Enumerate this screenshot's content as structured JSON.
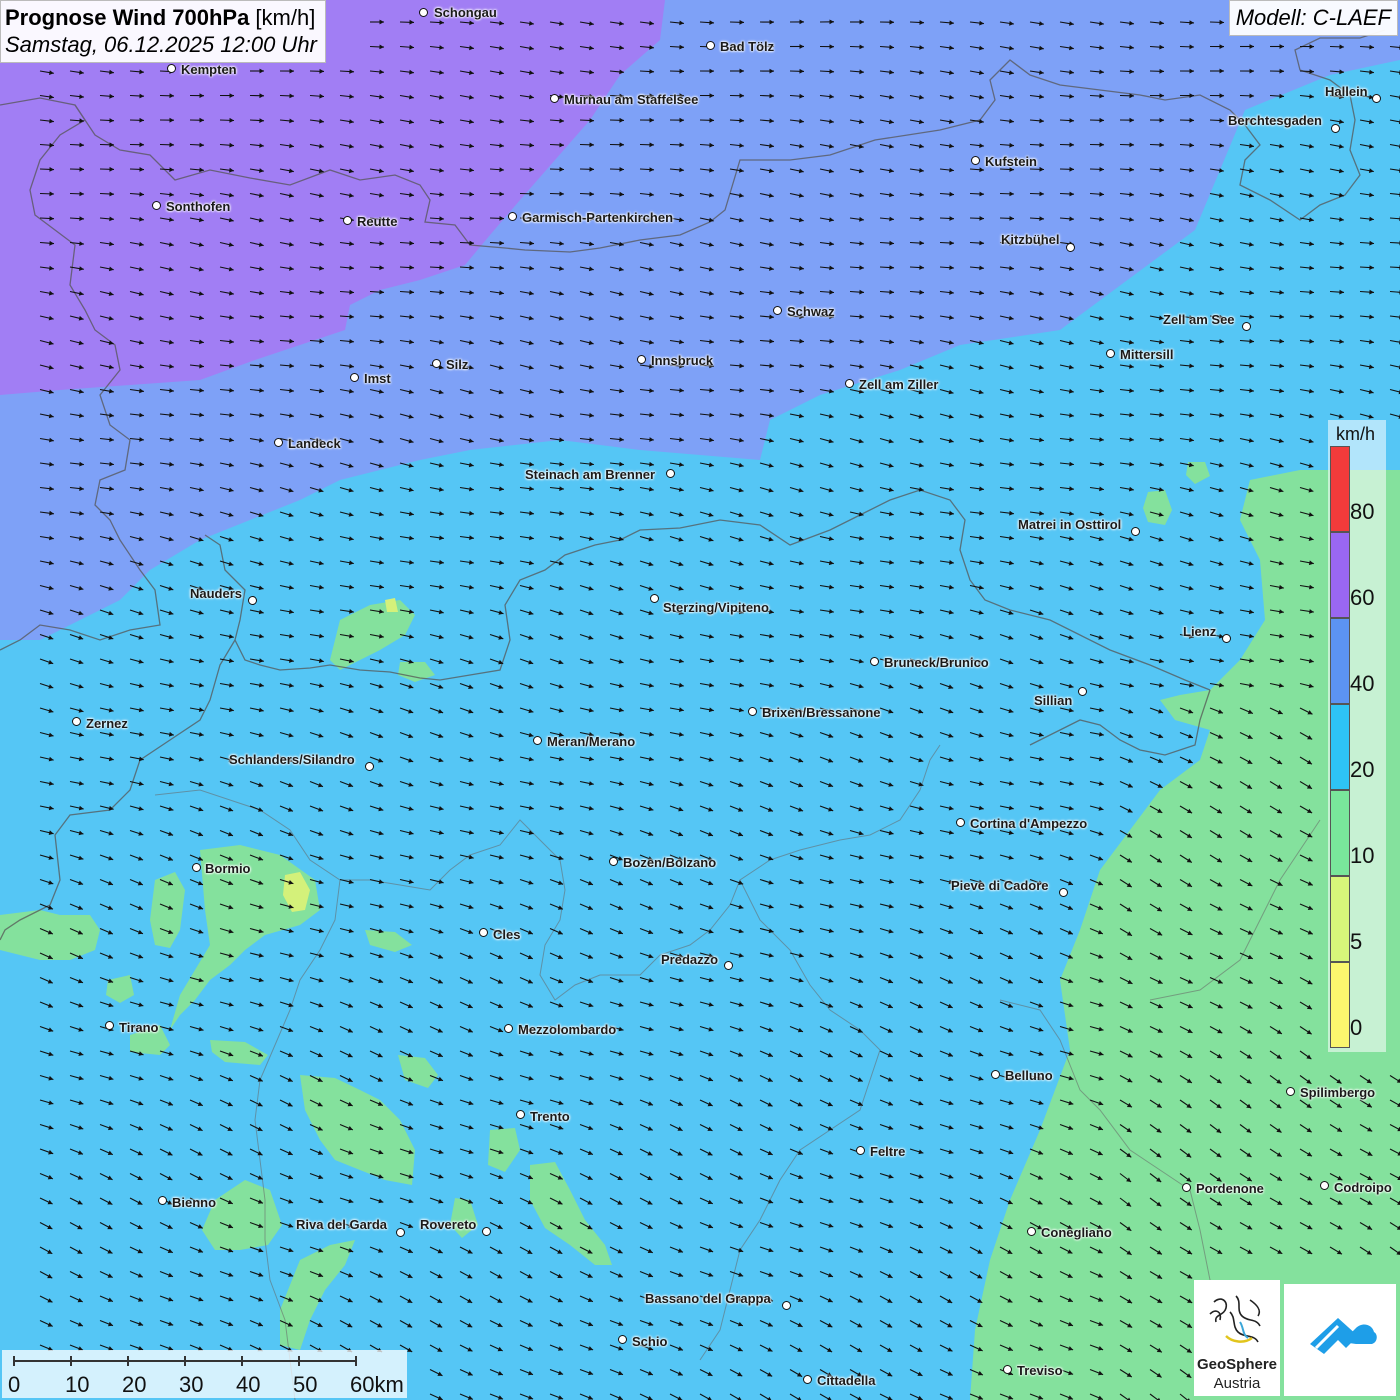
{
  "title": {
    "main_bold": "Prognose Wind 700hPa",
    "unit": " [km/h]",
    "datetime": "Samstag, 06.12.2025 12:00 Uhr"
  },
  "model": "Modell: C-LAEF",
  "legend": {
    "unit": "km/h",
    "labels": [
      "80",
      "60",
      "40",
      "20",
      "10",
      "5",
      "0"
    ],
    "colors": [
      "#f23b3b",
      "#9a67f2",
      "#5c93f3",
      "#2ec3f5",
      "#79e79b",
      "#d8f67a",
      "#fbf76e"
    ]
  },
  "scale": {
    "labels": [
      "0",
      "10",
      "20",
      "30",
      "40",
      "50",
      "60km"
    ]
  },
  "colors": {
    "purple_zone": "#a17ef4",
    "blue_zone": "#7ea1f7",
    "cyan_zone": "#55c6f5",
    "green_zone": "#84e19d",
    "yellow_zone": "#d4f17a"
  },
  "logos": {
    "geosphere_line1": "GeoSphere",
    "geosphere_line2": "Austria"
  },
  "cities": [
    {
      "name": "Schongau",
      "dot": [
        424,
        13
      ],
      "lbl": [
        434,
        5
      ]
    },
    {
      "name": "Bad Tölz",
      "dot": [
        711,
        46
      ],
      "lbl": [
        720,
        39
      ]
    },
    {
      "name": "Kempten",
      "dot": [
        172,
        69
      ],
      "lbl": [
        181,
        62
      ]
    },
    {
      "name": "Murnau am Staffelsee",
      "dot": [
        555,
        99
      ],
      "lbl": [
        564,
        92
      ]
    },
    {
      "name": "Hallein",
      "dot": [
        1377,
        99
      ],
      "lbl": [
        1325,
        84
      ]
    },
    {
      "name": "Berchtesgaden",
      "dot": [
        1336,
        129
      ],
      "lbl": [
        1228,
        113
      ]
    },
    {
      "name": "Kufstein",
      "dot": [
        976,
        161
      ],
      "lbl": [
        985,
        154
      ]
    },
    {
      "name": "Sonthofen",
      "dot": [
        157,
        206
      ],
      "lbl": [
        166,
        199
      ]
    },
    {
      "name": "Reutte",
      "dot": [
        348,
        221
      ],
      "lbl": [
        357,
        214
      ]
    },
    {
      "name": "Garmisch-Partenkirchen",
      "dot": [
        513,
        217
      ],
      "lbl": [
        522,
        210
      ]
    },
    {
      "name": "Kitzbühel",
      "dot": [
        1071,
        248
      ],
      "lbl": [
        1001,
        232
      ]
    },
    {
      "name": "Schwaz",
      "dot": [
        778,
        311
      ],
      "lbl": [
        787,
        304
      ]
    },
    {
      "name": "Zell am See",
      "dot": [
        1247,
        327
      ],
      "lbl": [
        1163,
        312
      ]
    },
    {
      "name": "Mittersill",
      "dot": [
        1111,
        354
      ],
      "lbl": [
        1120,
        347
      ]
    },
    {
      "name": "Innsbruck",
      "dot": [
        642,
        360
      ],
      "lbl": [
        651,
        353
      ]
    },
    {
      "name": "Silz",
      "dot": [
        437,
        364
      ],
      "lbl": [
        446,
        357
      ]
    },
    {
      "name": "Imst",
      "dot": [
        355,
        378
      ],
      "lbl": [
        364,
        371
      ]
    },
    {
      "name": "Zell am Ziller",
      "dot": [
        850,
        384
      ],
      "lbl": [
        859,
        377
      ]
    },
    {
      "name": "Landeck",
      "dot": [
        279,
        443
      ],
      "lbl": [
        288,
        436
      ]
    },
    {
      "name": "Steinach am Brenner",
      "dot": [
        671,
        474
      ],
      "lbl": [
        525,
        467
      ]
    },
    {
      "name": "Matrei in Osttirol",
      "dot": [
        1136,
        532
      ],
      "lbl": [
        1018,
        517
      ]
    },
    {
      "name": "Nauders",
      "dot": [
        253,
        601
      ],
      "lbl": [
        190,
        586
      ]
    },
    {
      "name": "Sterzing/Vipiteno",
      "dot": [
        655,
        599
      ],
      "lbl": [
        663,
        600
      ]
    },
    {
      "name": "Lienz",
      "dot": [
        1227,
        639
      ],
      "lbl": [
        1183,
        624
      ]
    },
    {
      "name": "Bruneck/Brunico",
      "dot": [
        875,
        662
      ],
      "lbl": [
        884,
        655
      ]
    },
    {
      "name": "Sillian",
      "dot": [
        1083,
        692
      ],
      "lbl": [
        1034,
        693
      ]
    },
    {
      "name": "Brixen/Bressanone",
      "dot": [
        753,
        712
      ],
      "lbl": [
        762,
        705
      ]
    },
    {
      "name": "Zernez",
      "dot": [
        77,
        722
      ],
      "lbl": [
        86,
        716
      ]
    },
    {
      "name": "Meran/Merano",
      "dot": [
        538,
        741
      ],
      "lbl": [
        547,
        734
      ]
    },
    {
      "name": "Schlanders/Silandro",
      "dot": [
        370,
        767
      ],
      "lbl": [
        229,
        752
      ]
    },
    {
      "name": "Cortina d'Ampezzo",
      "dot": [
        961,
        823
      ],
      "lbl": [
        970,
        816
      ]
    },
    {
      "name": "Bozen/Bolzano",
      "dot": [
        614,
        862
      ],
      "lbl": [
        623,
        855
      ]
    },
    {
      "name": "Bormio",
      "dot": [
        197,
        868
      ],
      "lbl": [
        205,
        861
      ]
    },
    {
      "name": "Pieve di Cadore",
      "dot": [
        1064,
        893
      ],
      "lbl": [
        951,
        878
      ]
    },
    {
      "name": "Cles",
      "dot": [
        484,
        933
      ],
      "lbl": [
        493,
        927
      ]
    },
    {
      "name": "Predazzo",
      "dot": [
        729,
        966
      ],
      "lbl": [
        661,
        952
      ]
    },
    {
      "name": "Tirano",
      "dot": [
        110,
        1026
      ],
      "lbl": [
        119,
        1020
      ]
    },
    {
      "name": "Mezzolombardo",
      "dot": [
        509,
        1029
      ],
      "lbl": [
        518,
        1022
      ]
    },
    {
      "name": "Belluno",
      "dot": [
        996,
        1075
      ],
      "lbl": [
        1005,
        1068
      ]
    },
    {
      "name": "Spilimbergo",
      "dot": [
        1291,
        1092
      ],
      "lbl": [
        1300,
        1085
      ]
    },
    {
      "name": "Trento",
      "dot": [
        521,
        1115
      ],
      "lbl": [
        530,
        1109
      ]
    },
    {
      "name": "Feltre",
      "dot": [
        861,
        1151
      ],
      "lbl": [
        870,
        1144
      ]
    },
    {
      "name": "Pordenone",
      "dot": [
        1187,
        1188
      ],
      "lbl": [
        1196,
        1181
      ]
    },
    {
      "name": "Codroipo",
      "dot": [
        1325,
        1186
      ],
      "lbl": [
        1334,
        1180
      ]
    },
    {
      "name": "Bienno",
      "dot": [
        163,
        1201
      ],
      "lbl": [
        172,
        1195
      ]
    },
    {
      "name": "Riva del Garda",
      "dot": [
        401,
        1233
      ],
      "lbl": [
        296,
        1217
      ]
    },
    {
      "name": "Rovereto",
      "dot": [
        487,
        1232
      ],
      "lbl": [
        420,
        1217
      ]
    },
    {
      "name": "Conegliano",
      "dot": [
        1032,
        1232
      ],
      "lbl": [
        1041,
        1225
      ]
    },
    {
      "name": "Bassano del Grappa",
      "dot": [
        787,
        1306
      ],
      "lbl": [
        645,
        1291
      ]
    },
    {
      "name": "Schio",
      "dot": [
        623,
        1340
      ],
      "lbl": [
        632,
        1334
      ]
    },
    {
      "name": "Treviso",
      "dot": [
        1008,
        1370
      ],
      "lbl": [
        1017,
        1363
      ]
    },
    {
      "name": "Cittadella",
      "dot": [
        808,
        1380
      ],
      "lbl": [
        817,
        1373
      ]
    }
  ]
}
